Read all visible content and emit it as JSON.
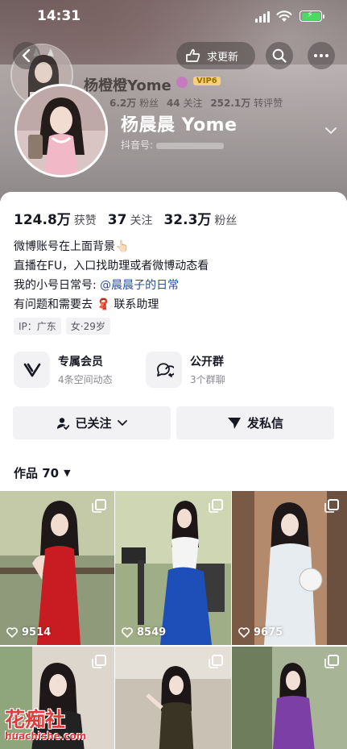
{
  "status": {
    "time": "14:31"
  },
  "header": {
    "update_label": "求更新",
    "ghost": {
      "name": "杨橙橙Yome",
      "vip": "VIP6",
      "stats": [
        {
          "num": "6.2万",
          "label": "粉丝"
        },
        {
          "num": "44",
          "label": "关注"
        },
        {
          "num": "252.1万",
          "label": "转评赞"
        }
      ]
    },
    "display_name": "杨晨晨 Yome",
    "douyin_id_label": "抖音号:"
  },
  "stats": [
    {
      "num": "124.8万",
      "label": "获赞"
    },
    {
      "num": "37",
      "label": "关注"
    },
    {
      "num": "32.3万",
      "label": "粉丝"
    }
  ],
  "bio": {
    "line1": "微博账号在上面背景👆🏻",
    "line2": "直播在FU，入口找助理或者微博动态看",
    "line3_prefix": "我的小号日常号: ",
    "line3_link": "@晨晨子的日常",
    "line4": "有问题和需要去 🧣 联系助理"
  },
  "tags": [
    "IP：广东",
    "女·29岁"
  ],
  "features": [
    {
      "title": "专属会员",
      "sub": "4条空间动态"
    },
    {
      "title": "公开群",
      "sub": "3个群聊"
    }
  ],
  "actions": {
    "followed": "已关注",
    "message": "发私信"
  },
  "works": {
    "label": "作品 70",
    "tiles": [
      {
        "likes": "9514"
      },
      {
        "likes": "8549"
      },
      {
        "likes": "9675"
      },
      {
        "likes": ""
      },
      {
        "likes": ""
      },
      {
        "likes": ""
      }
    ]
  },
  "watermark": {
    "brand": "花痴社",
    "domain": "huachishe.com"
  },
  "colors": {
    "link": "#2c4f8f",
    "accent_red": "#fe2c55"
  }
}
